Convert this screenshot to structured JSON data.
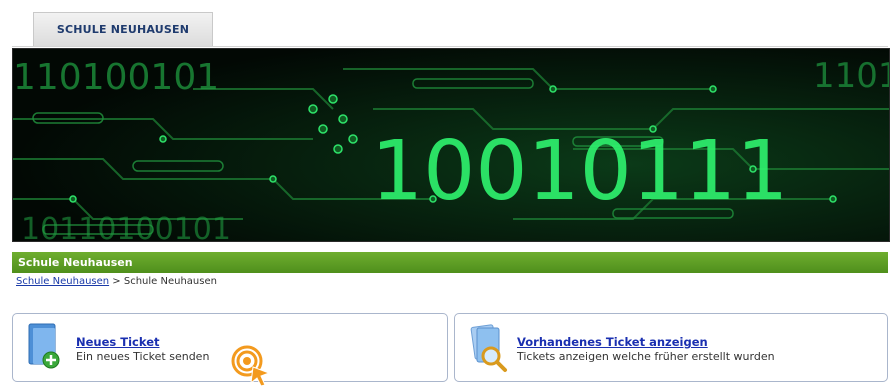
{
  "header": {
    "tab_label": "SCHULE NEUHAUSEN"
  },
  "banner": {
    "digits_large": "10010111",
    "digits_top": "110100101",
    "digits_bottom": "10110100101",
    "digits_top_right": "1101"
  },
  "section": {
    "title": "Schule Neuhausen"
  },
  "breadcrumb": {
    "link": "Schule Neuhausen",
    "separator": " > ",
    "current": "Schule Neuhausen"
  },
  "cards": {
    "new_ticket": {
      "title": "Neues Ticket",
      "subtitle": "Ein neues Ticket senden",
      "icon": "document-add-icon"
    },
    "existing_ticket": {
      "title": "Vorhandenes Ticket anzeigen",
      "subtitle": "Tickets anzeigen welche früher erstellt wurden",
      "icon": "document-search-icon"
    }
  },
  "colors": {
    "accent_green": "#5a9a22",
    "link_blue": "#1a2fb0",
    "tab_text": "#1f3b6e"
  }
}
